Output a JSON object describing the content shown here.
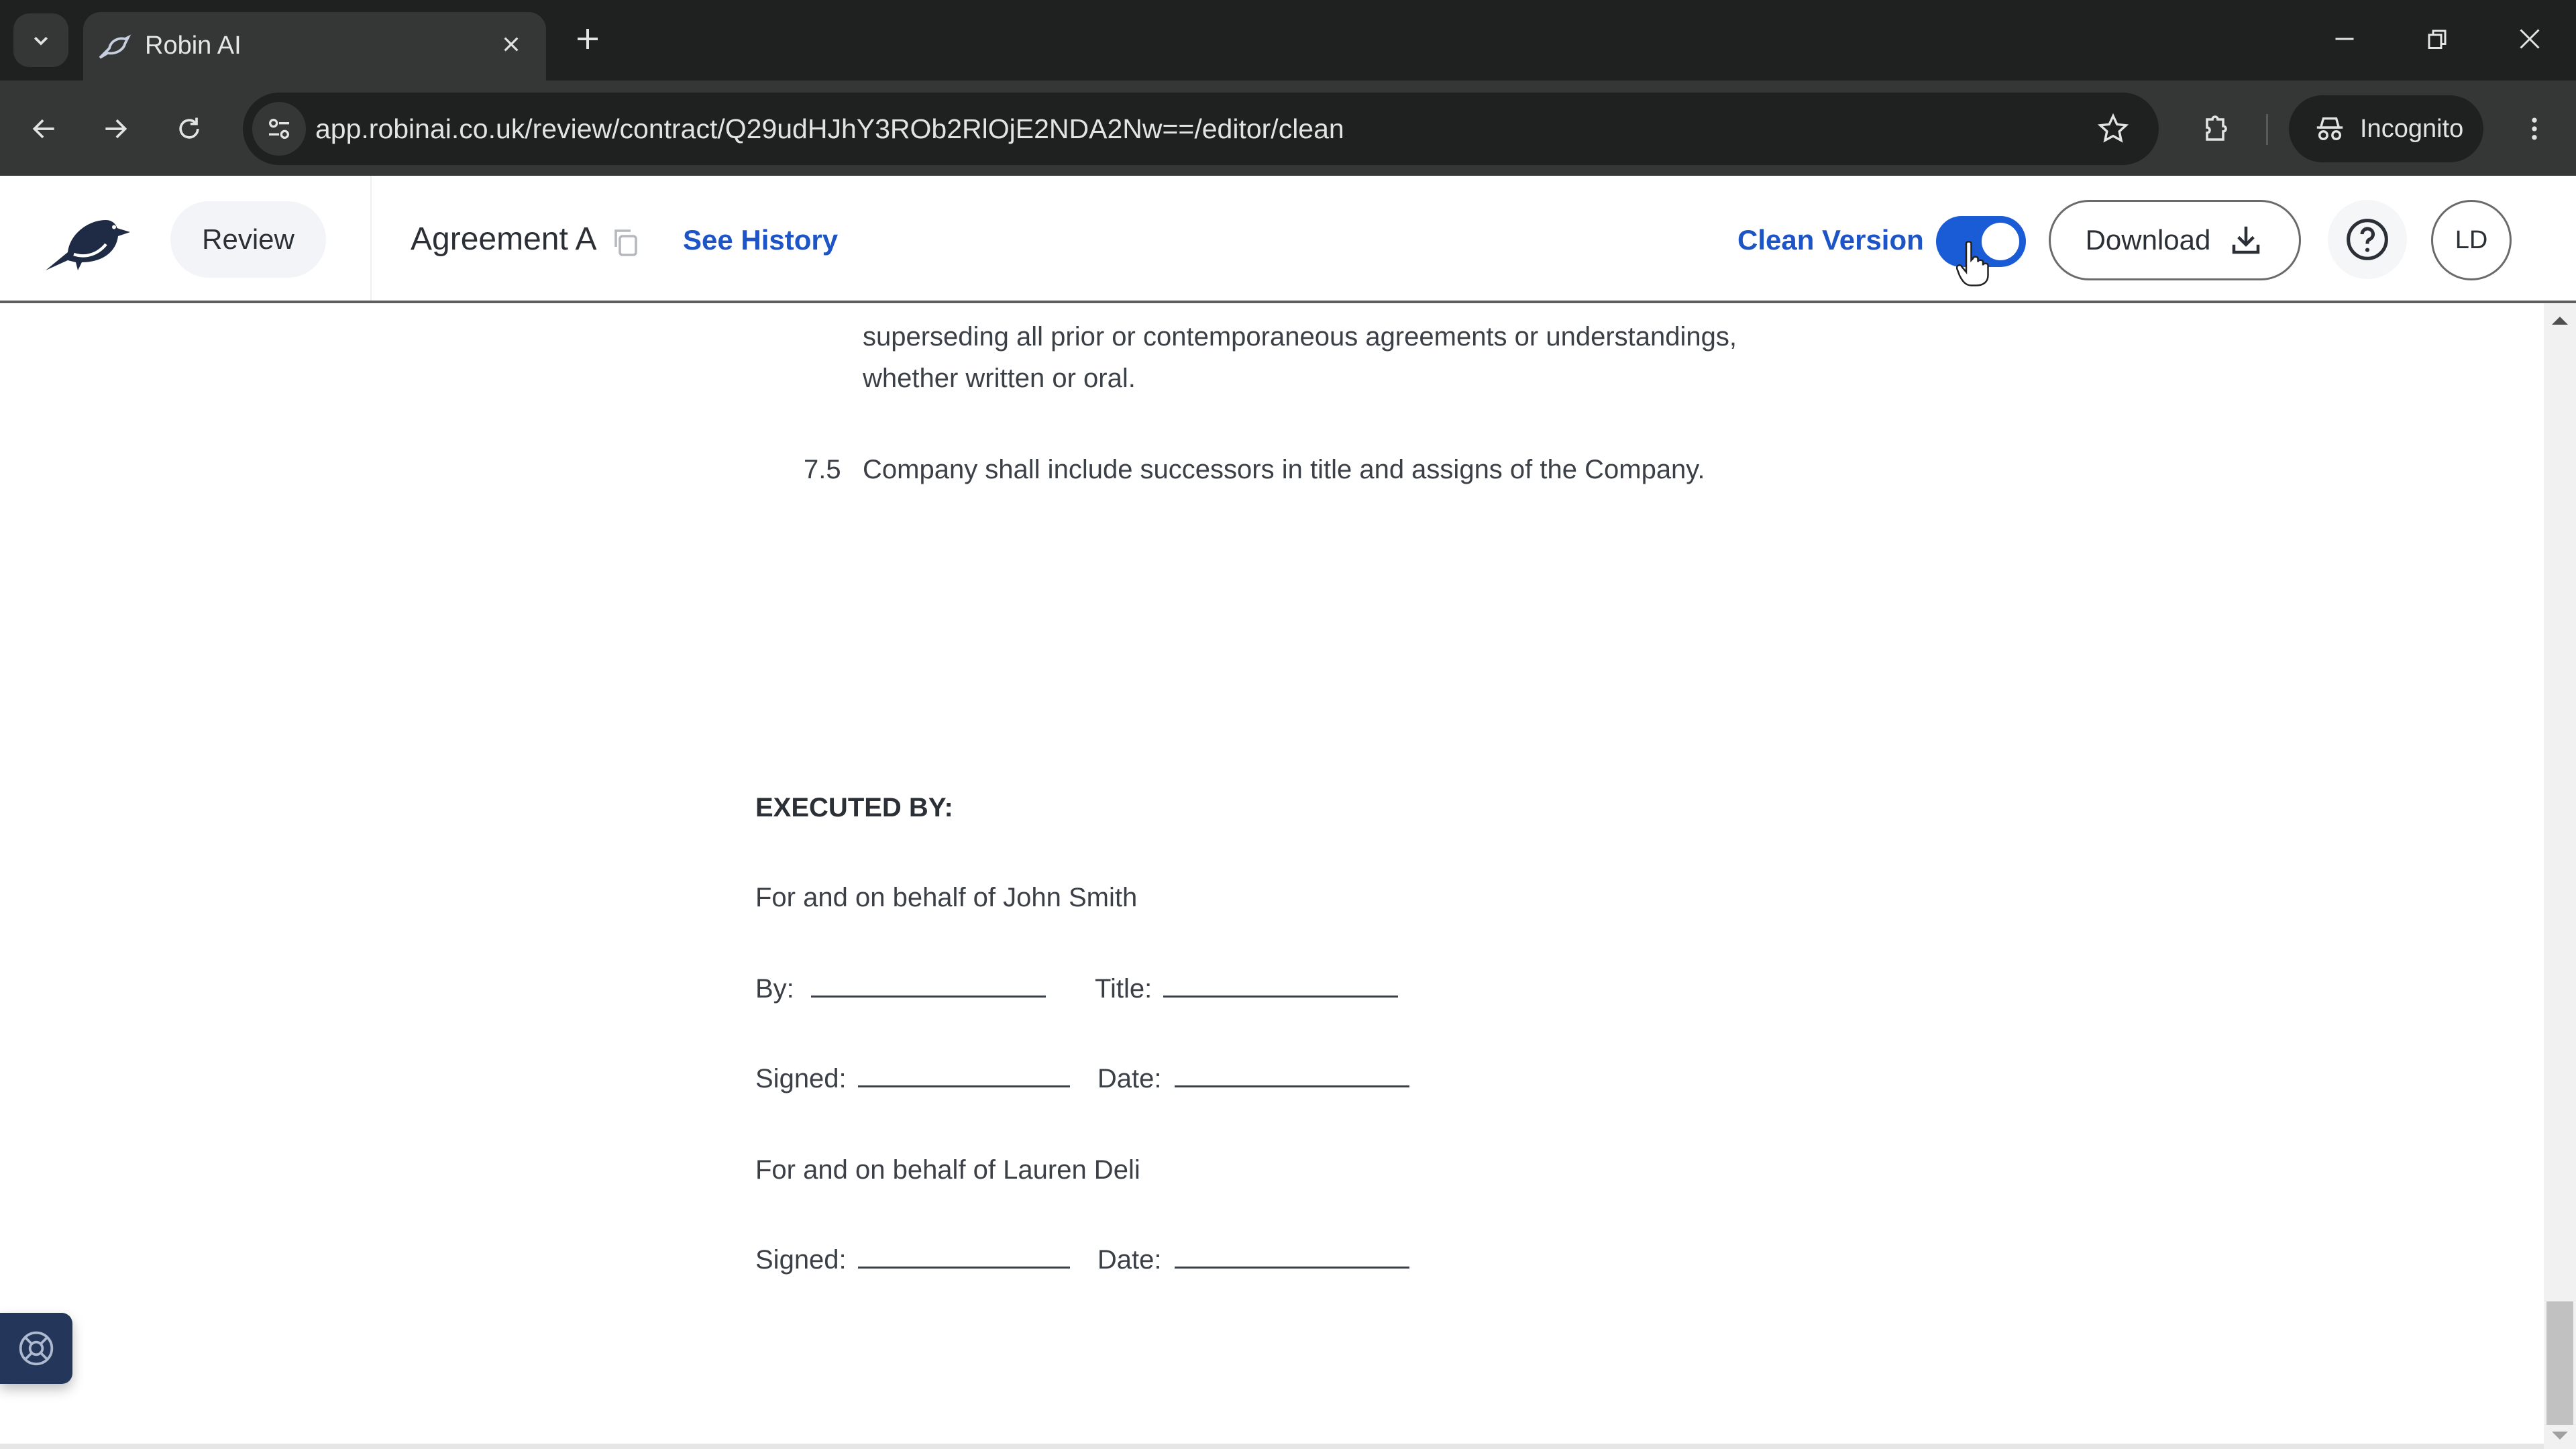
{
  "browser": {
    "tab_title": "Robin AI",
    "url": "app.robinai.co.uk/review/contract/Q29udHJhY3ROb2RlOjE2NDA2Nw==/editor/clean",
    "incognito_label": "Incognito"
  },
  "header": {
    "nav_label": "Review",
    "document_title": "Agreement A",
    "see_history_label": "See History",
    "clean_version_label": "Clean Version",
    "clean_version_on": true,
    "download_label": "Download",
    "avatar_initials": "LD"
  },
  "colors": {
    "accent_blue": "#1d55c6",
    "toggle_blue": "#1a5bd6",
    "navy": "#24365a"
  },
  "document": {
    "clause_tail_line1": "superseding all prior or contemporaneous agreements or understandings,",
    "clause_tail_line2": "whether written or oral.",
    "clause_7_5_number": "7.5",
    "clause_7_5_text": "Company shall include successors in title and assigns of the Company.",
    "executed_by": "EXECUTED BY:",
    "party1_line": "For and on behalf of John Smith",
    "by_label": "By:",
    "title_label": "Title:",
    "signed_label": "Signed:",
    "date_label": "Date:",
    "party2_line": "For and on behalf of Lauren Deli"
  }
}
